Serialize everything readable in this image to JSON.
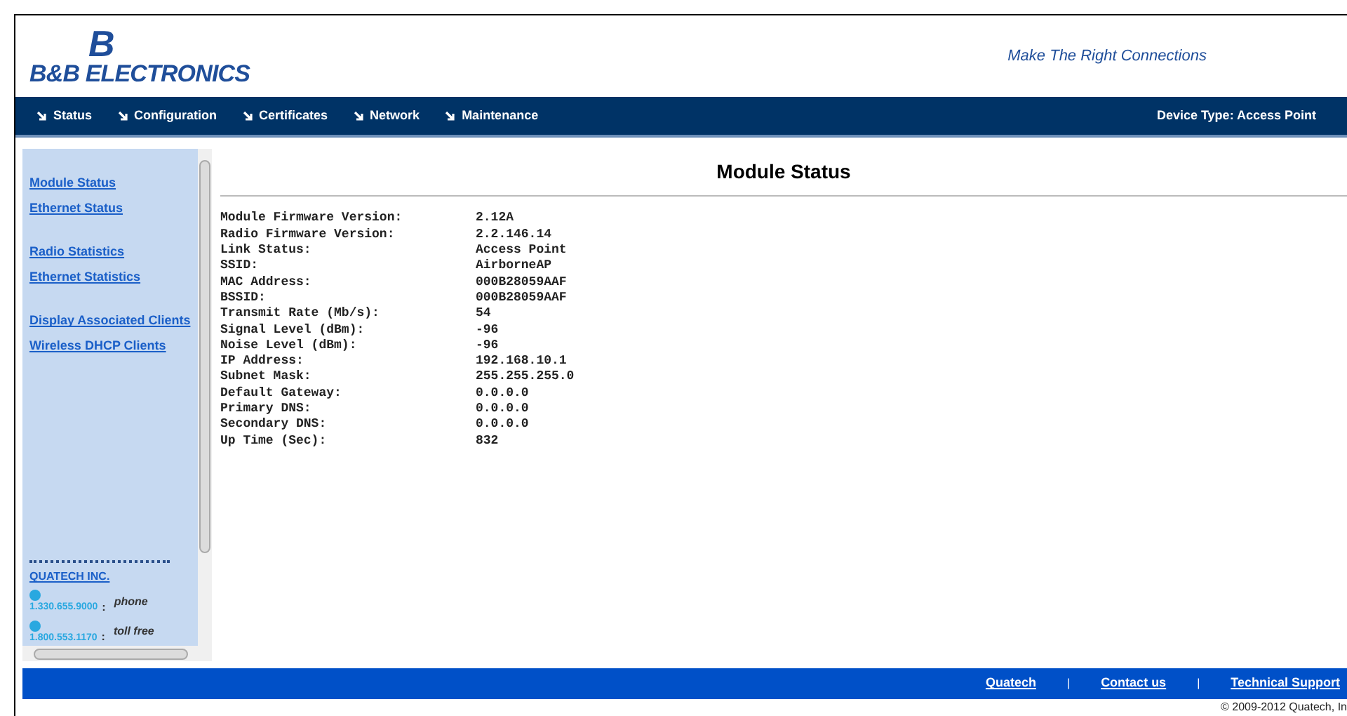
{
  "header": {
    "logo_mark": "B",
    "logo_text": "B&B ELECTRONICS",
    "tagline": "Make The Right Connections"
  },
  "nav": {
    "items": [
      {
        "label": "Status"
      },
      {
        "label": "Configuration"
      },
      {
        "label": "Certificates"
      },
      {
        "label": "Network"
      },
      {
        "label": "Maintenance"
      }
    ],
    "device_type": "Device Type: Access Point"
  },
  "sidebar": {
    "groups": [
      [
        "Module Status",
        "Ethernet Status"
      ],
      [
        "Radio Statistics",
        "Ethernet Statistics"
      ],
      [
        "Display Associated Clients",
        "Wireless DHCP Clients"
      ]
    ],
    "company": "QUATECH INC.",
    "contacts": [
      {
        "number": "1.330.655.9000",
        "colon": ":",
        "label": "phone"
      },
      {
        "number": "1.800.553.1170",
        "colon": ":",
        "label": "toll free"
      }
    ]
  },
  "main": {
    "title": "Module Status",
    "rows": [
      {
        "label": "Module Firmware Version:",
        "value": "2.12A"
      },
      {
        "label": "Radio Firmware Version:",
        "value": "2.2.146.14"
      },
      {
        "label": "Link Status:",
        "value": "Access Point"
      },
      {
        "label": "SSID:",
        "value": "AirborneAP"
      },
      {
        "label": "MAC Address:",
        "value": "000B28059AAF"
      },
      {
        "label": "BSSID:",
        "value": "000B28059AAF"
      },
      {
        "label": "Transmit Rate (Mb/s):",
        "value": "54"
      },
      {
        "label": "Signal Level (dBm):",
        "value": "-96"
      },
      {
        "label": "Noise Level (dBm):",
        "value": "-96"
      },
      {
        "label": "IP Address:",
        "value": "192.168.10.1"
      },
      {
        "label": "Subnet Mask:",
        "value": "255.255.255.0"
      },
      {
        "label": "Default Gateway:",
        "value": "0.0.0.0"
      },
      {
        "label": "Primary DNS:",
        "value": "0.0.0.0"
      },
      {
        "label": "Secondary DNS:",
        "value": "0.0.0.0"
      },
      {
        "label": "Up Time (Sec):",
        "value": "832"
      }
    ]
  },
  "footer": {
    "links": [
      "Quatech",
      "Contact us",
      "Technical Support"
    ],
    "separator": "|",
    "copyright": "© 2009-2012 Quatech, In"
  }
}
